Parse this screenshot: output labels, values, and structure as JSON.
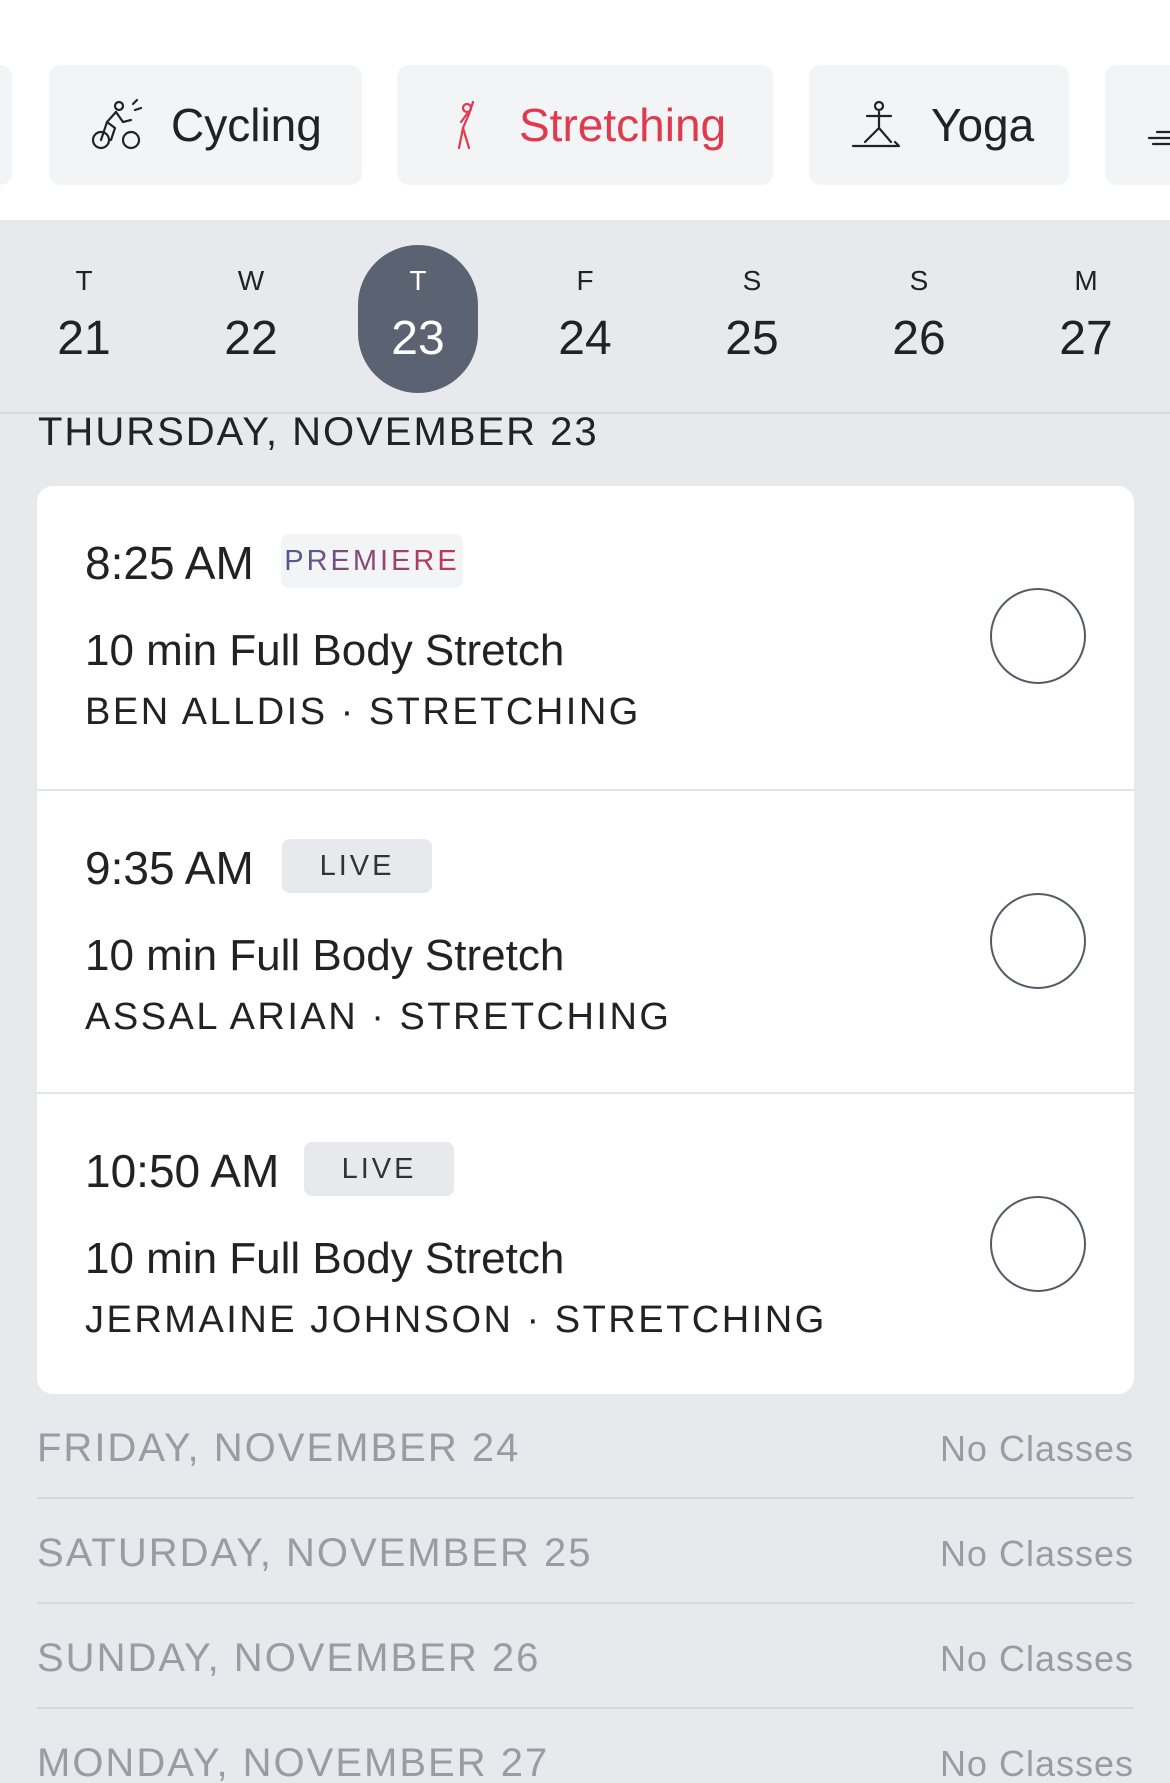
{
  "categories": [
    {
      "label": "Cycling",
      "icon": "cycling-icon",
      "active": false
    },
    {
      "label": "Stretching",
      "icon": "stretching-icon",
      "active": true
    },
    {
      "label": "Yoga",
      "icon": "yoga-icon",
      "active": false
    }
  ],
  "days": [
    {
      "dow": "T",
      "num": "21"
    },
    {
      "dow": "W",
      "num": "22"
    },
    {
      "dow": "T",
      "num": "23",
      "selected": true
    },
    {
      "dow": "F",
      "num": "24"
    },
    {
      "dow": "S",
      "num": "25"
    },
    {
      "dow": "S",
      "num": "26"
    },
    {
      "dow": "M",
      "num": "27"
    }
  ],
  "section_title": "THURSDAY, NOVEMBER 23",
  "classes": [
    {
      "time": "8:25 AM",
      "badge": "PREMIERE",
      "title": "10 min Full Body Stretch",
      "meta": "BEN ALLDIS · STRETCHING"
    },
    {
      "time": "9:35 AM",
      "badge": "LIVE",
      "title": "10 min Full Body Stretch",
      "meta": "ASSAL ARIAN · STRETCHING"
    },
    {
      "time": "10:50 AM",
      "badge": "LIVE",
      "title": "10 min Full Body Stretch",
      "meta": "JERMAINE JOHNSON · STRETCHING"
    }
  ],
  "empty_days": [
    {
      "label": "FRIDAY, NOVEMBER 24",
      "status": "No Classes"
    },
    {
      "label": "SATURDAY, NOVEMBER 25",
      "status": "No Classes"
    },
    {
      "label": "SUNDAY, NOVEMBER 26",
      "status": "No Classes"
    },
    {
      "label": "MONDAY, NOVEMBER 27",
      "status": "No Classes"
    }
  ],
  "colors": {
    "accent": "#e03a4e",
    "selected_day": "#5b6271",
    "muted_text": "#9a9ca3"
  }
}
